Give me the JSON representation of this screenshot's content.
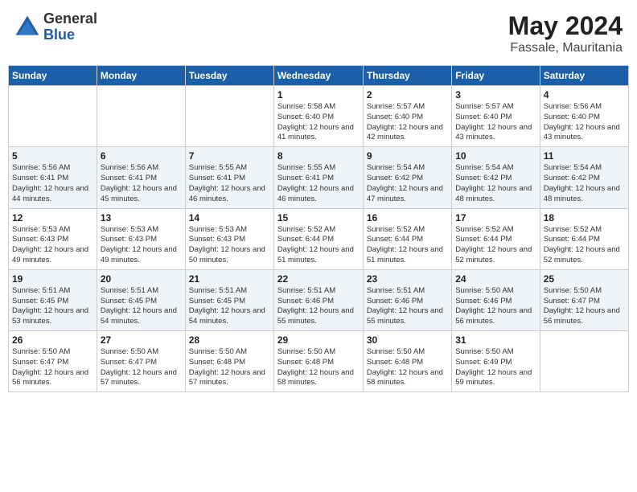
{
  "header": {
    "logo_general": "General",
    "logo_blue": "Blue",
    "month_year": "May 2024",
    "location": "Fassale, Mauritania"
  },
  "weekdays": [
    "Sunday",
    "Monday",
    "Tuesday",
    "Wednesday",
    "Thursday",
    "Friday",
    "Saturday"
  ],
  "weeks": [
    [
      {
        "day": "",
        "info": ""
      },
      {
        "day": "",
        "info": ""
      },
      {
        "day": "",
        "info": ""
      },
      {
        "day": "1",
        "info": "Sunrise: 5:58 AM\nSunset: 6:40 PM\nDaylight: 12 hours\nand 41 minutes."
      },
      {
        "day": "2",
        "info": "Sunrise: 5:57 AM\nSunset: 6:40 PM\nDaylight: 12 hours\nand 42 minutes."
      },
      {
        "day": "3",
        "info": "Sunrise: 5:57 AM\nSunset: 6:40 PM\nDaylight: 12 hours\nand 43 minutes."
      },
      {
        "day": "4",
        "info": "Sunrise: 5:56 AM\nSunset: 6:40 PM\nDaylight: 12 hours\nand 43 minutes."
      }
    ],
    [
      {
        "day": "5",
        "info": "Sunrise: 5:56 AM\nSunset: 6:41 PM\nDaylight: 12 hours\nand 44 minutes."
      },
      {
        "day": "6",
        "info": "Sunrise: 5:56 AM\nSunset: 6:41 PM\nDaylight: 12 hours\nand 45 minutes."
      },
      {
        "day": "7",
        "info": "Sunrise: 5:55 AM\nSunset: 6:41 PM\nDaylight: 12 hours\nand 46 minutes."
      },
      {
        "day": "8",
        "info": "Sunrise: 5:55 AM\nSunset: 6:41 PM\nDaylight: 12 hours\nand 46 minutes."
      },
      {
        "day": "9",
        "info": "Sunrise: 5:54 AM\nSunset: 6:42 PM\nDaylight: 12 hours\nand 47 minutes."
      },
      {
        "day": "10",
        "info": "Sunrise: 5:54 AM\nSunset: 6:42 PM\nDaylight: 12 hours\nand 48 minutes."
      },
      {
        "day": "11",
        "info": "Sunrise: 5:54 AM\nSunset: 6:42 PM\nDaylight: 12 hours\nand 48 minutes."
      }
    ],
    [
      {
        "day": "12",
        "info": "Sunrise: 5:53 AM\nSunset: 6:43 PM\nDaylight: 12 hours\nand 49 minutes."
      },
      {
        "day": "13",
        "info": "Sunrise: 5:53 AM\nSunset: 6:43 PM\nDaylight: 12 hours\nand 49 minutes."
      },
      {
        "day": "14",
        "info": "Sunrise: 5:53 AM\nSunset: 6:43 PM\nDaylight: 12 hours\nand 50 minutes."
      },
      {
        "day": "15",
        "info": "Sunrise: 5:52 AM\nSunset: 6:44 PM\nDaylight: 12 hours\nand 51 minutes."
      },
      {
        "day": "16",
        "info": "Sunrise: 5:52 AM\nSunset: 6:44 PM\nDaylight: 12 hours\nand 51 minutes."
      },
      {
        "day": "17",
        "info": "Sunrise: 5:52 AM\nSunset: 6:44 PM\nDaylight: 12 hours\nand 52 minutes."
      },
      {
        "day": "18",
        "info": "Sunrise: 5:52 AM\nSunset: 6:44 PM\nDaylight: 12 hours\nand 52 minutes."
      }
    ],
    [
      {
        "day": "19",
        "info": "Sunrise: 5:51 AM\nSunset: 6:45 PM\nDaylight: 12 hours\nand 53 minutes."
      },
      {
        "day": "20",
        "info": "Sunrise: 5:51 AM\nSunset: 6:45 PM\nDaylight: 12 hours\nand 54 minutes."
      },
      {
        "day": "21",
        "info": "Sunrise: 5:51 AM\nSunset: 6:45 PM\nDaylight: 12 hours\nand 54 minutes."
      },
      {
        "day": "22",
        "info": "Sunrise: 5:51 AM\nSunset: 6:46 PM\nDaylight: 12 hours\nand 55 minutes."
      },
      {
        "day": "23",
        "info": "Sunrise: 5:51 AM\nSunset: 6:46 PM\nDaylight: 12 hours\nand 55 minutes."
      },
      {
        "day": "24",
        "info": "Sunrise: 5:50 AM\nSunset: 6:46 PM\nDaylight: 12 hours\nand 56 minutes."
      },
      {
        "day": "25",
        "info": "Sunrise: 5:50 AM\nSunset: 6:47 PM\nDaylight: 12 hours\nand 56 minutes."
      }
    ],
    [
      {
        "day": "26",
        "info": "Sunrise: 5:50 AM\nSunset: 6:47 PM\nDaylight: 12 hours\nand 56 minutes."
      },
      {
        "day": "27",
        "info": "Sunrise: 5:50 AM\nSunset: 6:47 PM\nDaylight: 12 hours\nand 57 minutes."
      },
      {
        "day": "28",
        "info": "Sunrise: 5:50 AM\nSunset: 6:48 PM\nDaylight: 12 hours\nand 57 minutes."
      },
      {
        "day": "29",
        "info": "Sunrise: 5:50 AM\nSunset: 6:48 PM\nDaylight: 12 hours\nand 58 minutes."
      },
      {
        "day": "30",
        "info": "Sunrise: 5:50 AM\nSunset: 6:48 PM\nDaylight: 12 hours\nand 58 minutes."
      },
      {
        "day": "31",
        "info": "Sunrise: 5:50 AM\nSunset: 6:49 PM\nDaylight: 12 hours\nand 59 minutes."
      },
      {
        "day": "",
        "info": ""
      }
    ]
  ]
}
